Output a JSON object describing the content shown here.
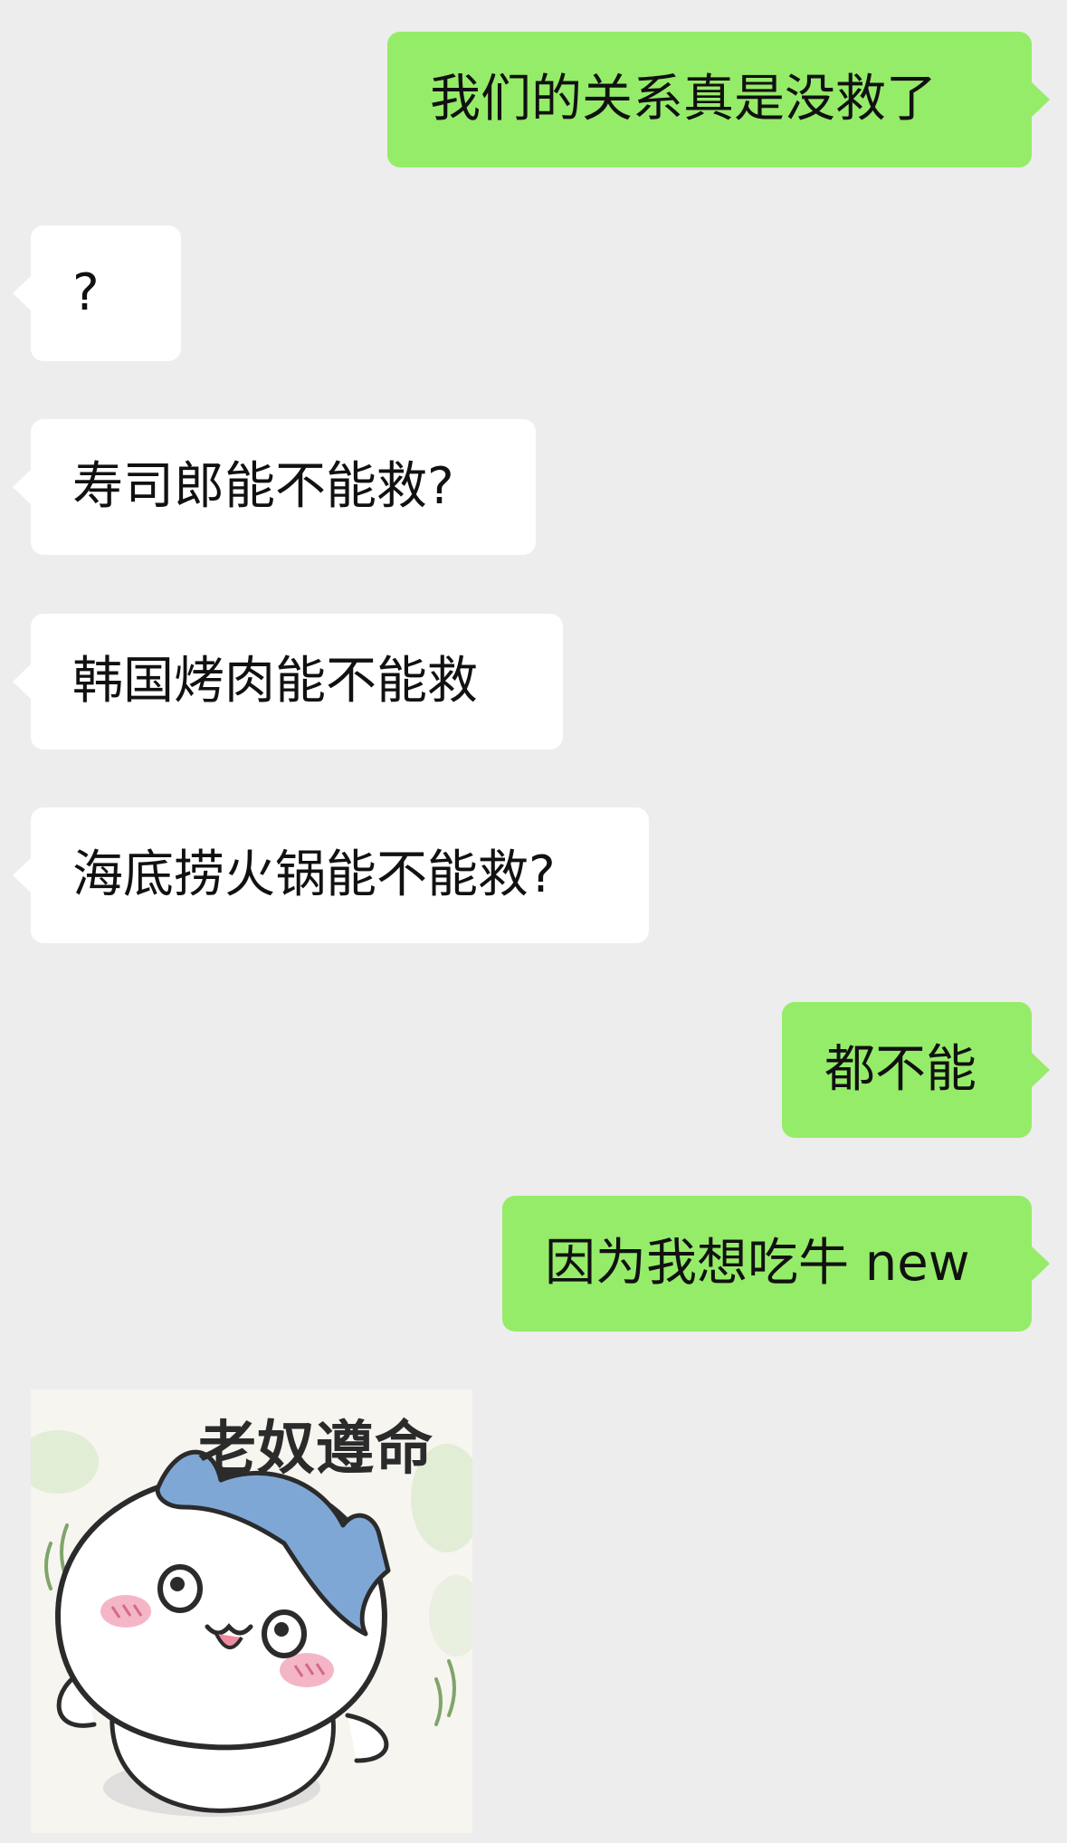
{
  "messages": [
    {
      "side": "sent",
      "text": "我们的关系真是没救了"
    },
    {
      "side": "received",
      "text": "?"
    },
    {
      "side": "received",
      "text": "寿司郎能不能救?"
    },
    {
      "side": "received",
      "text": "韩国烤肉能不能救"
    },
    {
      "side": "received",
      "text": "海底捞火锅能不能救?"
    },
    {
      "side": "sent",
      "text": "都不能"
    },
    {
      "side": "sent",
      "text": "因为我想吃牛 new"
    }
  ],
  "sticker": {
    "caption": "老奴遵命",
    "icon": "cat-character-sticker"
  },
  "colors": {
    "background": "#EDEDED",
    "sent_bubble": "#95EC69",
    "received_bubble": "#FFFFFF",
    "text": "#111111"
  }
}
